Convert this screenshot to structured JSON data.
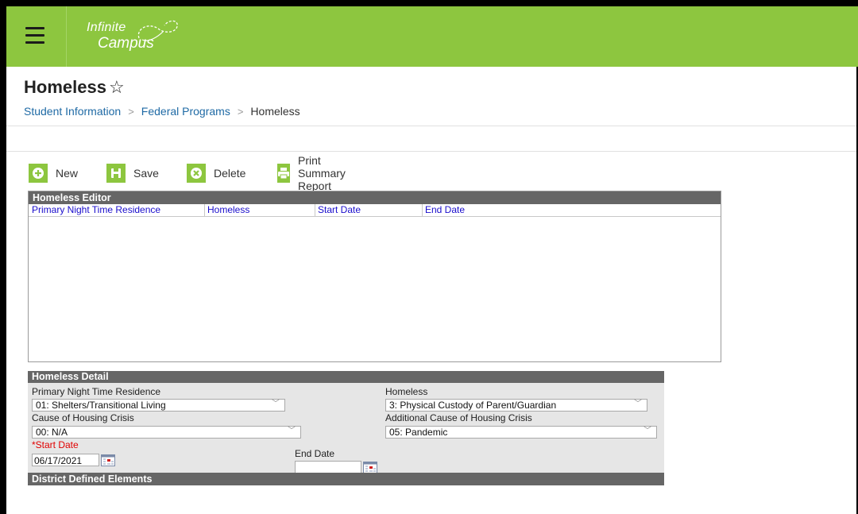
{
  "header": {
    "logo_line1": "Infinite",
    "logo_line2": "Campus"
  },
  "page": {
    "title": "Homeless",
    "breadcrumb": [
      "Student Information",
      "Federal Programs",
      "Homeless"
    ]
  },
  "toolbar": {
    "new_label": "New",
    "save_label": "Save",
    "delete_label": "Delete",
    "print_label": "Print Summary Report"
  },
  "editor": {
    "title": "Homeless Editor",
    "columns": [
      "Primary Night Time Residence",
      "Homeless",
      "Start Date",
      "End Date"
    ],
    "rows": []
  },
  "detail": {
    "title": "Homeless Detail",
    "primary_residence_label": "Primary Night Time Residence",
    "primary_residence_value": "01: Shelters/Transitional Living",
    "homeless_label": "Homeless",
    "homeless_value": "3: Physical Custody of Parent/Guardian",
    "cause_label": "Cause of Housing Crisis",
    "cause_value": "00: N/A",
    "additional_cause_label": "Additional Cause of Housing Crisis",
    "additional_cause_value": "05: Pandemic",
    "start_date_label": "*Start Date",
    "start_date_value": "06/17/2021",
    "end_date_label": "End Date",
    "end_date_value": "",
    "district_defined_title": "District Defined Elements"
  },
  "colors": {
    "brand_green": "#8dc63f",
    "panel_header": "#666666",
    "link_blue": "#1f6aa5",
    "column_blue": "#1a0dcc",
    "required_red": "#e00000"
  },
  "icons": [
    "menu-icon",
    "campus-logo",
    "star-outline-icon",
    "plus-icon",
    "save-icon",
    "delete-x-icon",
    "print-icon",
    "calendar-icon",
    "chevron-down-icon"
  ]
}
